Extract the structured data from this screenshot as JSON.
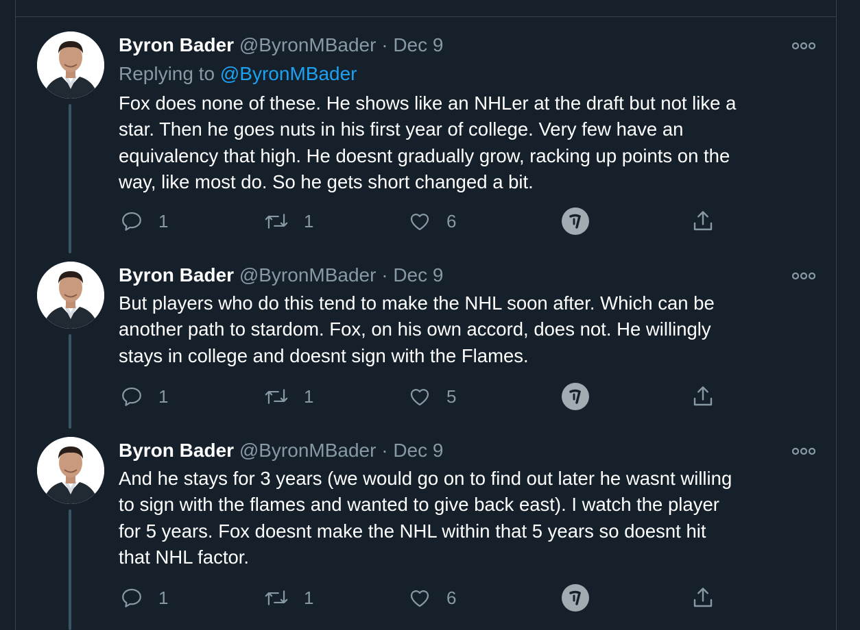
{
  "tweets": [
    {
      "name": "Byron Bader",
      "handle": "@ByronMBader",
      "separator": "·",
      "date": "Dec 9",
      "replying_prefix": "Replying to ",
      "replying_to": "@ByronMBader",
      "text": "Fox does none of these. He shows like an NHLer at the draft but not like a\nstar. Then he goes nuts in his first year of college. Very few have an\nequivalency that high. He doesnt gradually grow, racking up points on the\nway, like most do. So he gets short changed a bit.",
      "replies": "1",
      "retweets": "1",
      "likes": "6"
    },
    {
      "name": "Byron Bader",
      "handle": "@ByronMBader",
      "separator": "·",
      "date": "Dec 9",
      "text": "But players who do this tend to make the NHL soon after. Which can be\nanother path to stardom. Fox, on his own accord, does not. He willingly\nstays in college and doesnt sign with the Flames.",
      "replies": "1",
      "retweets": "1",
      "likes": "5"
    },
    {
      "name": "Byron Bader",
      "handle": "@ByronMBader",
      "separator": "·",
      "date": "Dec 9",
      "text": "And he stays for 3 years (we would go on to find out later he wasnt willing\nto sign with the flames and wanted to give back east). I watch the player\nfor 5 years. Fox doesnt make the NHL within that 5 years so doesnt hit\nthat NHL factor.",
      "replies": "1",
      "retweets": "1",
      "likes": "6"
    }
  ],
  "icons": {
    "reply": "reply-icon",
    "retweet": "retweet-icon",
    "like": "heart-icon",
    "extension": "extension-badge-icon",
    "share": "share-icon",
    "more": "more-options-icon"
  },
  "colors": {
    "background": "#15202b",
    "text": "#ffffff",
    "muted": "#8899a6",
    "link": "#1da1f2",
    "border": "#38444d"
  }
}
